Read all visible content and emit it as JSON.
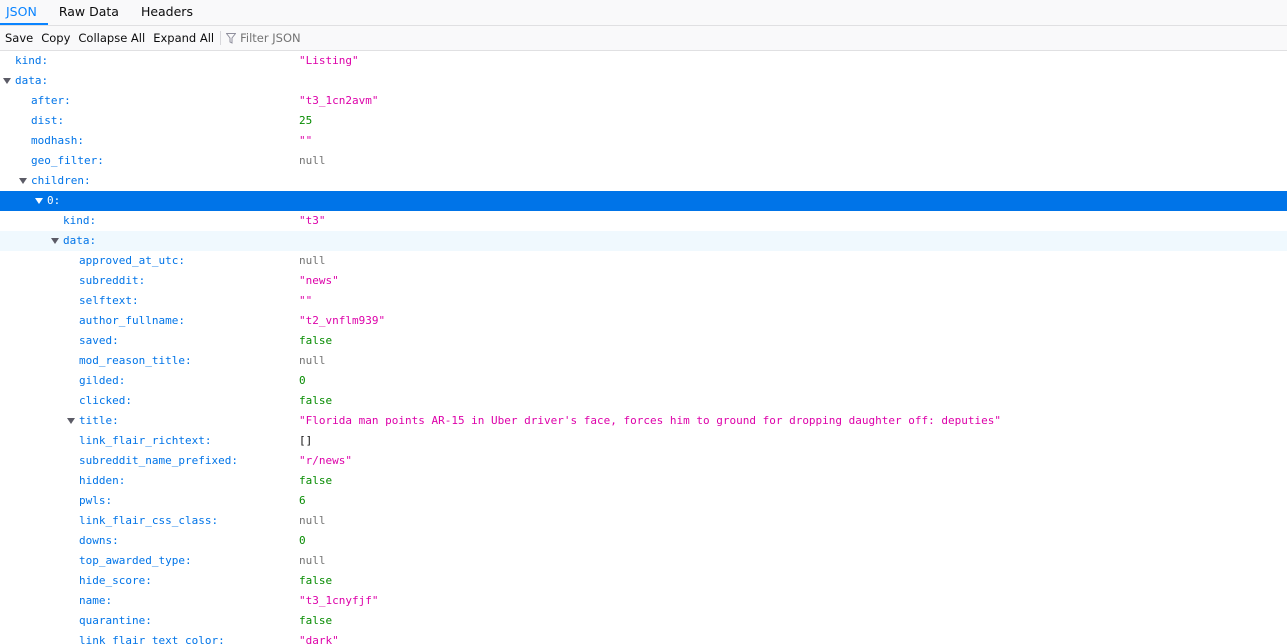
{
  "tabs": [
    {
      "label": "JSON",
      "active": true
    },
    {
      "label": "Raw Data",
      "active": false
    },
    {
      "label": "Headers",
      "active": false
    }
  ],
  "toolbar": {
    "save_label": "Save",
    "copy_label": "Copy",
    "collapse_label": "Collapse All",
    "expand_label": "Expand All",
    "filter_placeholder": "Filter JSON"
  },
  "colors": {
    "accent": "#0a84ff",
    "selected_row": "#0074e8",
    "key": "#0074e8",
    "string": "#dd00a9",
    "number": "#058b00",
    "null": "#737373"
  },
  "rows": [
    {
      "depth": 0,
      "key": "kind:",
      "value": "\"Listing\"",
      "type": "str"
    },
    {
      "depth": 0,
      "key": "data:",
      "expandable": true,
      "value": ""
    },
    {
      "depth": 1,
      "key": "after:",
      "value": "\"t3_1cn2avm\"",
      "type": "str"
    },
    {
      "depth": 1,
      "key": "dist:",
      "value": "25",
      "type": "num"
    },
    {
      "depth": 1,
      "key": "modhash:",
      "value": "\"\"",
      "type": "str"
    },
    {
      "depth": 1,
      "key": "geo_filter:",
      "value": "null",
      "type": "null"
    },
    {
      "depth": 1,
      "key": "children:",
      "expandable": true,
      "value": ""
    },
    {
      "depth": 2,
      "key": "0:",
      "expandable": true,
      "value": "",
      "selected": true
    },
    {
      "depth": 3,
      "key": "kind:",
      "value": "\"t3\"",
      "type": "str"
    },
    {
      "depth": 3,
      "key": "data:",
      "expandable": true,
      "value": "",
      "hover": true
    },
    {
      "depth": 4,
      "key": "approved_at_utc:",
      "value": "null",
      "type": "null"
    },
    {
      "depth": 4,
      "key": "subreddit:",
      "value": "\"news\"",
      "type": "str"
    },
    {
      "depth": 4,
      "key": "selftext:",
      "value": "\"\"",
      "type": "str"
    },
    {
      "depth": 4,
      "key": "author_fullname:",
      "value": "\"t2_vnflm939\"",
      "type": "str"
    },
    {
      "depth": 4,
      "key": "saved:",
      "value": "false",
      "type": "bool"
    },
    {
      "depth": 4,
      "key": "mod_reason_title:",
      "value": "null",
      "type": "null"
    },
    {
      "depth": 4,
      "key": "gilded:",
      "value": "0",
      "type": "num"
    },
    {
      "depth": 4,
      "key": "clicked:",
      "value": "false",
      "type": "bool"
    },
    {
      "depth": 4,
      "key": "title:",
      "expandable": true,
      "value": "\"Florida man points AR-15 in Uber driver's face, forces him to ground for dropping daughter off: deputies\"",
      "type": "str"
    },
    {
      "depth": 4,
      "key": "link_flair_richtext:",
      "value": "[]",
      "type": "arr"
    },
    {
      "depth": 4,
      "key": "subreddit_name_prefixed:",
      "value": "\"r/news\"",
      "type": "str"
    },
    {
      "depth": 4,
      "key": "hidden:",
      "value": "false",
      "type": "bool"
    },
    {
      "depth": 4,
      "key": "pwls:",
      "value": "6",
      "type": "num"
    },
    {
      "depth": 4,
      "key": "link_flair_css_class:",
      "value": "null",
      "type": "null"
    },
    {
      "depth": 4,
      "key": "downs:",
      "value": "0",
      "type": "num"
    },
    {
      "depth": 4,
      "key": "top_awarded_type:",
      "value": "null",
      "type": "null"
    },
    {
      "depth": 4,
      "key": "hide_score:",
      "value": "false",
      "type": "bool"
    },
    {
      "depth": 4,
      "key": "name:",
      "value": "\"t3_1cnyfjf\"",
      "type": "str"
    },
    {
      "depth": 4,
      "key": "quarantine:",
      "value": "false",
      "type": "bool"
    },
    {
      "depth": 4,
      "key": "link_flair_text_color:",
      "value": "\"dark\"",
      "type": "str"
    }
  ]
}
